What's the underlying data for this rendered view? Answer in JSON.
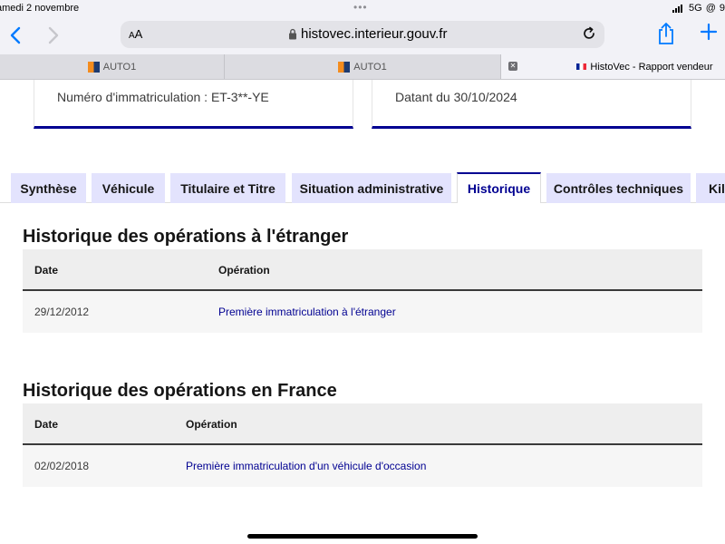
{
  "status_bar": {
    "datetime": "amedi 2 novembre",
    "network": "5G",
    "battery_partial": "9"
  },
  "browser": {
    "text_size_label": "AA",
    "url": "histovec.interieur.gouv.fr",
    "tabs": [
      {
        "label": "AUTO1"
      },
      {
        "label": "AUTO1"
      },
      {
        "label": "HistoVec - Rapport vendeur",
        "active": true
      }
    ]
  },
  "header_cards": {
    "plate_label": "Numéro d'immatriculation : ET-3**-YE",
    "report_date": "Datant du 30/10/2024"
  },
  "page_tabs": [
    {
      "label": "Synthèse",
      "active": false
    },
    {
      "label": "Véhicule",
      "active": false
    },
    {
      "label": "Titulaire et Titre",
      "active": false
    },
    {
      "label": "Situation administrative",
      "active": false
    },
    {
      "label": "Historique",
      "active": true
    },
    {
      "label": "Contrôles techniques",
      "active": false
    },
    {
      "label": "Kilométrage",
      "active": false
    }
  ],
  "sections": [
    {
      "title": "Historique des opérations à l'étranger",
      "columns": [
        "Date",
        "Opération"
      ],
      "rows": [
        {
          "date": "29/12/2012",
          "operation": "Première immatriculation à l'étranger"
        }
      ]
    },
    {
      "title": "Historique des opérations en France",
      "columns": [
        "Date",
        "Opération"
      ],
      "rows": [
        {
          "date": "02/02/2018",
          "operation": "Première immatriculation d'un véhicule d'occasion"
        }
      ]
    }
  ],
  "colors": {
    "primary_blue": "#000091",
    "tab_background": "#e3e3fd",
    "table_header": "#eeeeee",
    "table_row": "#f6f6f6"
  }
}
